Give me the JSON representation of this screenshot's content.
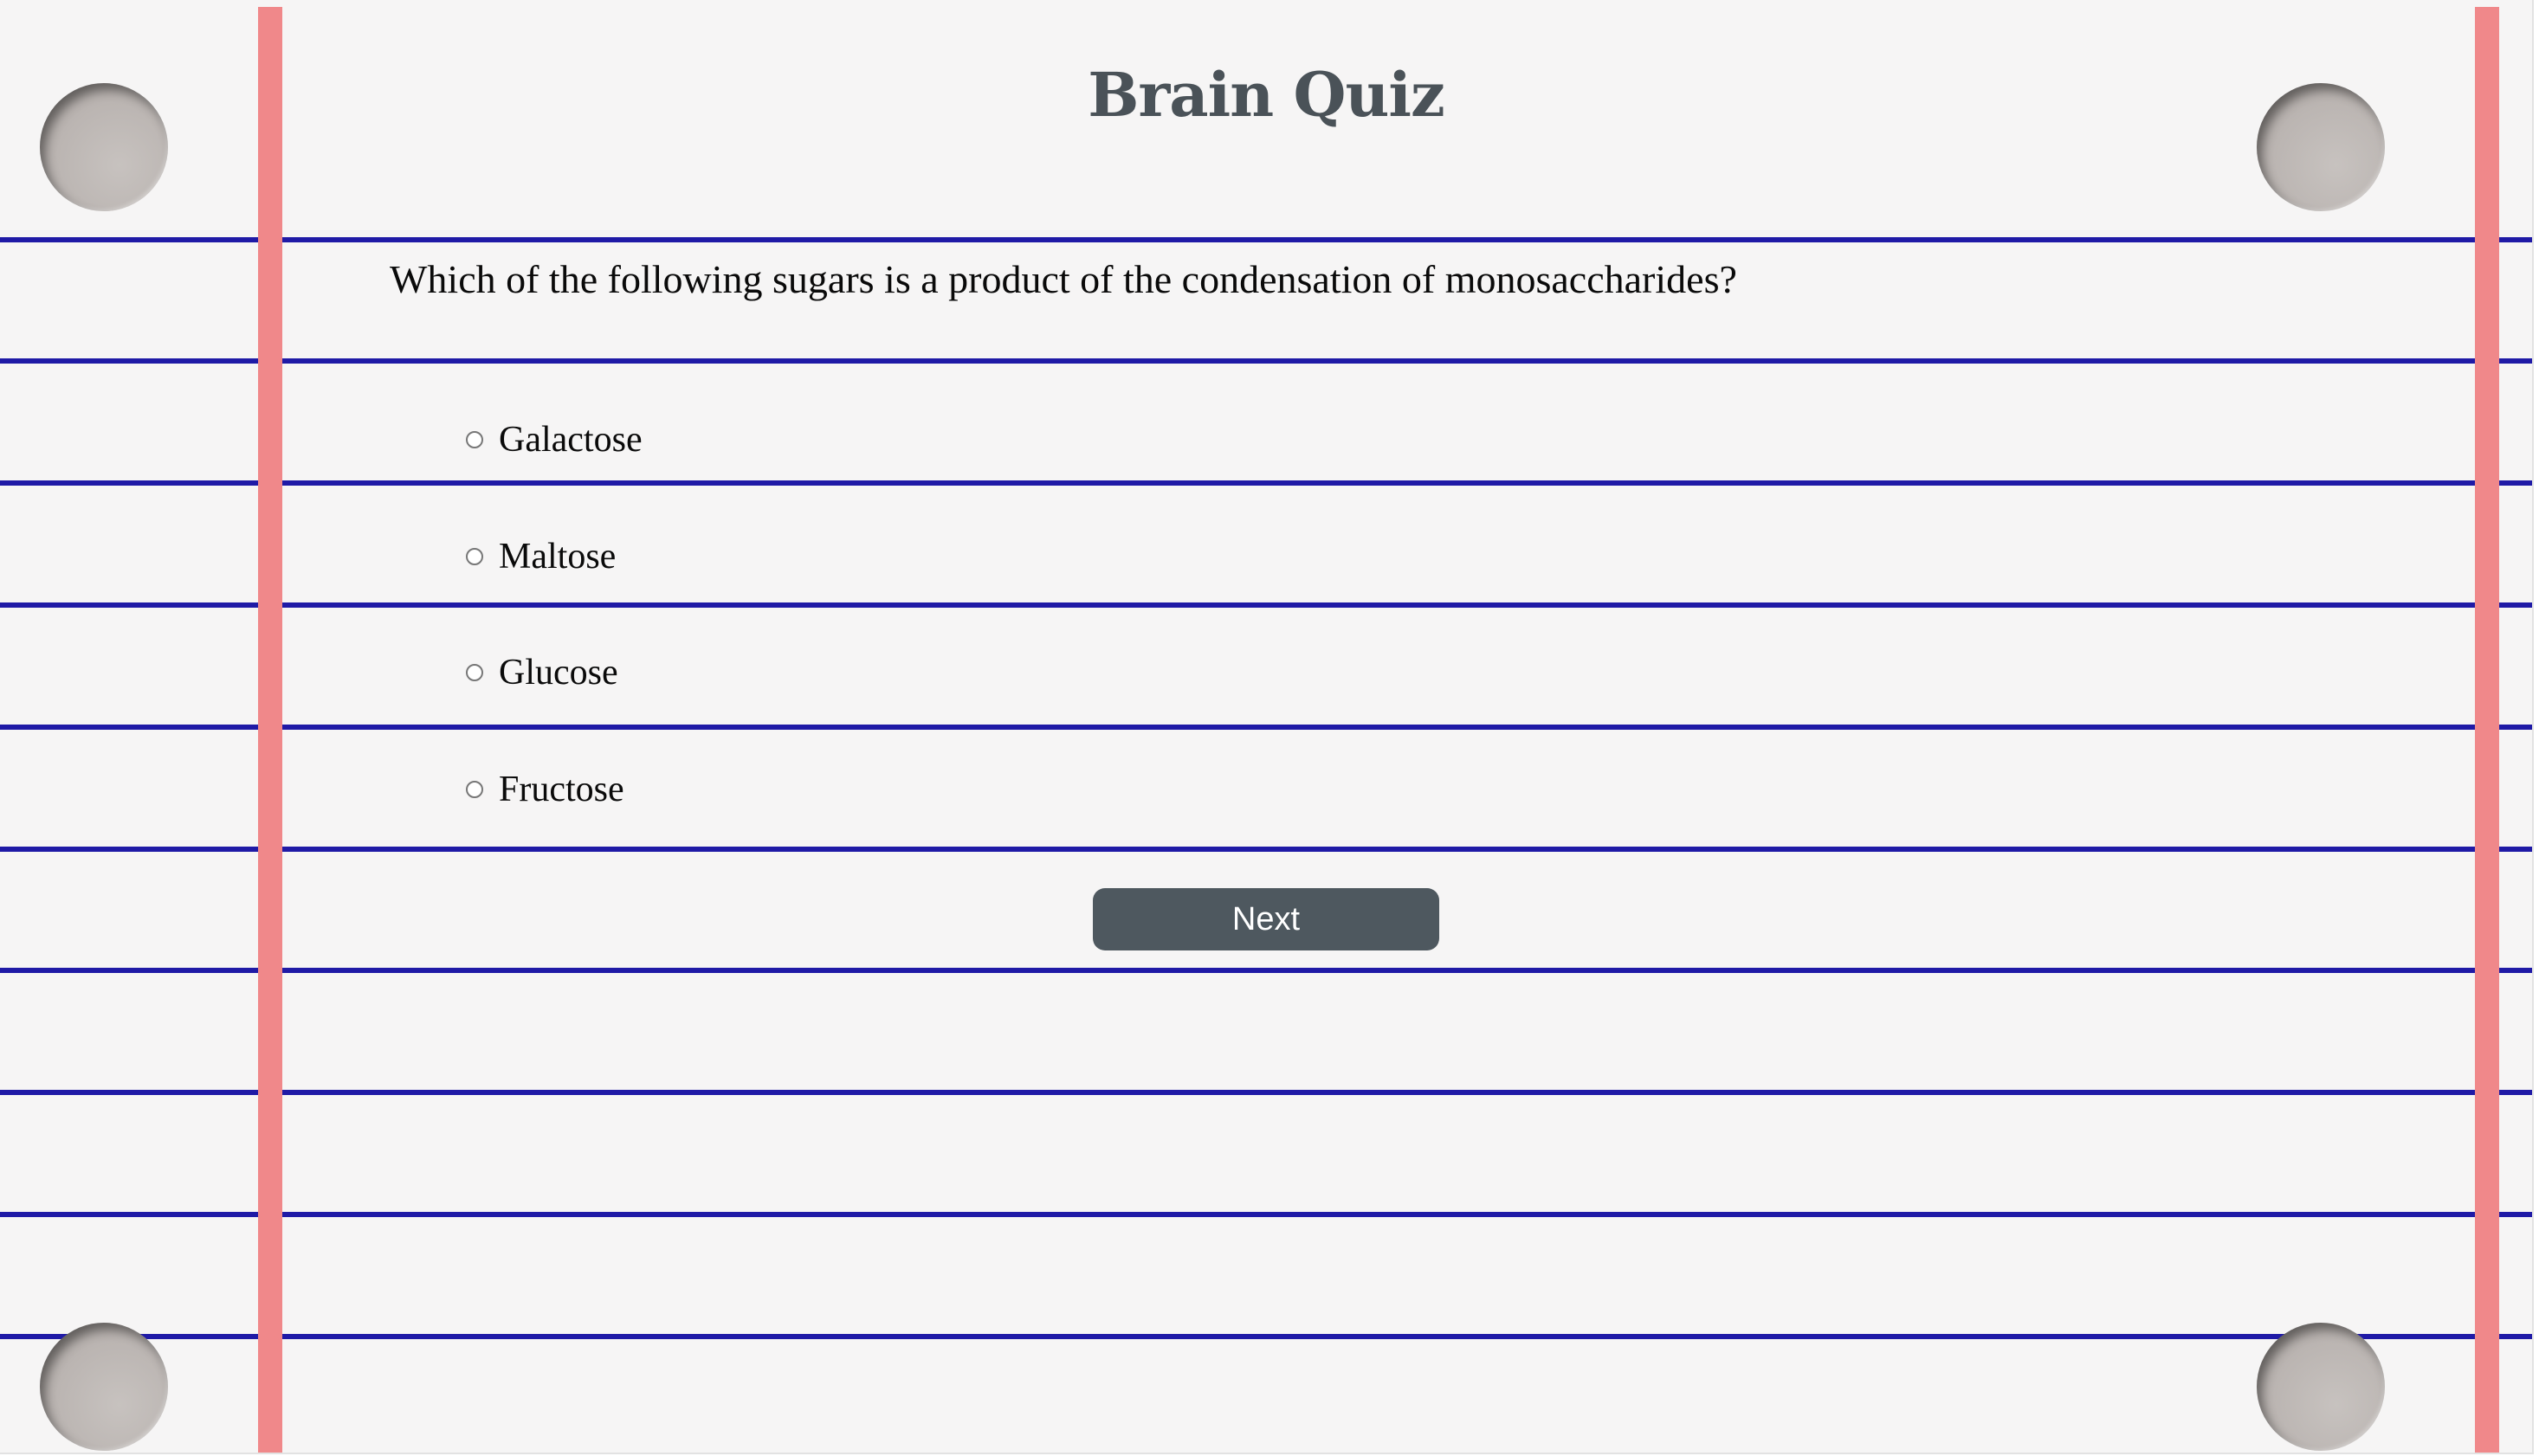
{
  "quiz": {
    "title": "Brain Quiz",
    "question": "Which of the following sugars is a product of the condensation of monosaccharides?",
    "options": [
      {
        "label": "Galactose",
        "selected": false
      },
      {
        "label": "Maltose",
        "selected": false
      },
      {
        "label": "Glucose",
        "selected": false
      },
      {
        "label": "Fructose",
        "selected": false
      }
    ],
    "next_label": "Next"
  },
  "theme": {
    "paper_color": "#f6f5f5",
    "rule_color": "#1f1aa6",
    "margin_color": "#f0888a",
    "title_color": "#4a5258",
    "button_color": "#4e585f"
  }
}
